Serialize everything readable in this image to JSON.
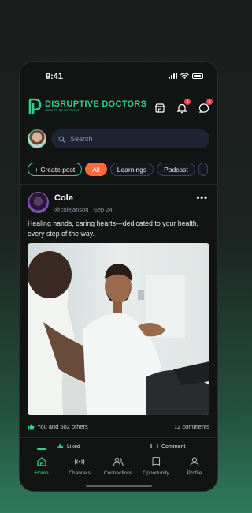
{
  "status_bar": {
    "time": "9:41"
  },
  "brand": {
    "name": "DISRUPTIVE DOCTORS",
    "tagline": "DARE TO BE DIFFERENT",
    "color": "#2fd08a"
  },
  "header": {
    "notifications_count": "1",
    "messages_count": "1"
  },
  "search": {
    "placeholder": "Search"
  },
  "chips": [
    "+ Create post",
    "All",
    "Learnings",
    "Podcast"
  ],
  "post": {
    "author": "Cole",
    "handle": "@colejanson",
    "date": "Sep 24",
    "text": "Healing hands, caring hearts—dedicated to your health, every step of the way.",
    "likes_text": "You and 502 others",
    "comments_text": "12 comments",
    "liked_label": "Liked",
    "comment_label": "Comment"
  },
  "tabs": [
    {
      "label": "Home",
      "icon": "home-icon",
      "active": true
    },
    {
      "label": "Channels",
      "icon": "broadcast-icon"
    },
    {
      "label": "Connections",
      "icon": "people-icon"
    },
    {
      "label": "Opportunity",
      "icon": "book-icon"
    },
    {
      "label": "Profile",
      "icon": "person-icon"
    }
  ]
}
